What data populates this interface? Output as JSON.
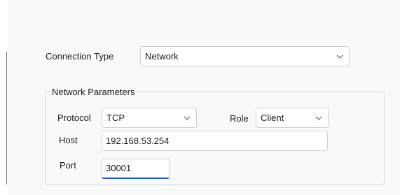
{
  "connection": {
    "label": "Connection Type",
    "value": "Network"
  },
  "network_params": {
    "title": "Network Parameters",
    "protocol": {
      "label": "Protocol",
      "value": "TCP"
    },
    "role": {
      "label": "Role",
      "value": "Client"
    },
    "host": {
      "label": "Host",
      "value": "192.168.53.254"
    },
    "port": {
      "label": "Port",
      "value": "30001"
    }
  },
  "icons": {
    "dropdown": "chevron-down-icon"
  },
  "colors": {
    "focus_accent": "#1a5fb4",
    "border": "#cfcfcf",
    "panel_background": "#f9f9f9"
  }
}
